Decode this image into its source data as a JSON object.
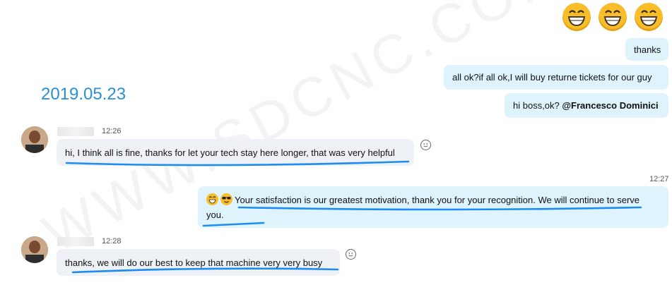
{
  "date_header": "2019.05.23",
  "watermark": "WWW.SDCNC.COM",
  "colors": {
    "accent": "#2a8fd6",
    "outgoing_bubble": "#dff3fd",
    "incoming_bubble": "#eef2f6",
    "underline": "#1c8cf0"
  },
  "top_reactions": [
    "grinning-emoji",
    "grinning-emoji",
    "grinning-emoji"
  ],
  "outgoing_top": [
    {
      "text": "thanks"
    },
    {
      "text": "all ok?if all ok,I will buy returne tickets for our guy"
    },
    {
      "text_prefix": "hi boss,ok? ",
      "mention": "@Francesco Dominici"
    }
  ],
  "incoming_1": {
    "time": "12:26",
    "text": "hi, I think all is fine, thanks for let your tech stay here longer, that was very helpful"
  },
  "outgoing_mid": {
    "time": "12:27",
    "emojis": [
      "grinning-emoji",
      "sunglasses-emoji"
    ],
    "text": "Your satisfaction is our greatest motivation, thank you for your recognition. We will continue to serve you."
  },
  "incoming_2": {
    "time": "12:28",
    "text": "thanks, we will do our best to keep that machine very very busy"
  }
}
